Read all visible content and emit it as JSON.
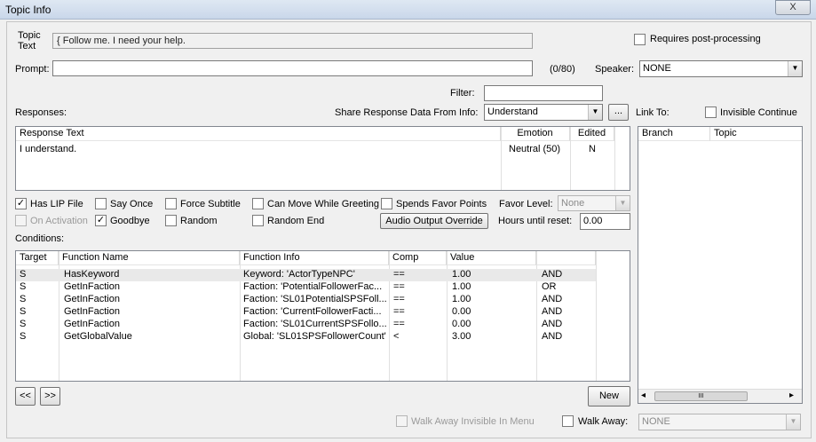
{
  "window": {
    "title": "Topic Info",
    "close_glyph": "X"
  },
  "topic": {
    "label_line1": "Topic",
    "label_line2": "Text",
    "value": "{ Follow me. I need your help.",
    "requires_post_processing_label": "Requires post-processing",
    "requires_post_processing_checked": false
  },
  "prompt": {
    "label": "Prompt:",
    "value": "",
    "counter": "(0/80)"
  },
  "speaker": {
    "label": "Speaker:",
    "value": "NONE"
  },
  "filter": {
    "label": "Filter:",
    "value": ""
  },
  "responses": {
    "label": "Responses:",
    "share_label": "Share Response Data From Info:",
    "share_value": "Understand",
    "ellipsis": "...",
    "columns": [
      "Response Text",
      "Emotion",
      "Edited"
    ],
    "rows": [
      {
        "text": "I understand.",
        "emotion": "Neutral (50)",
        "edited": "N"
      }
    ]
  },
  "link_to": {
    "label": "Link To:",
    "invisible_continue_label": "Invisible Continue",
    "invisible_continue_checked": false,
    "columns": [
      "Branch",
      "Topic"
    ],
    "scroll_left": "◂",
    "scroll_right": "▸",
    "scroll_thumb": "III"
  },
  "options": {
    "has_lip_file": {
      "label": "Has LIP File",
      "checked": true
    },
    "say_once": {
      "label": "Say Once",
      "checked": false
    },
    "force_subtitle": {
      "label": "Force Subtitle",
      "checked": false
    },
    "can_move_while_greeting": {
      "label": "Can Move While Greeting",
      "checked": false
    },
    "spends_favor_points": {
      "label": "Spends Favor Points",
      "checked": false
    },
    "favor_level_label": "Favor Level:",
    "favor_level_value": "None",
    "on_activation": {
      "label": "On Activation",
      "checked": false
    },
    "goodbye": {
      "label": "Goodbye",
      "checked": true
    },
    "random": {
      "label": "Random",
      "checked": false
    },
    "random_end": {
      "label": "Random End",
      "checked": false
    },
    "audio_output_override_label": "Audio Output Override",
    "hours_until_reset_label": "Hours until reset:",
    "hours_until_reset_value": "0.00"
  },
  "conditions": {
    "label": "Conditions:",
    "columns": [
      "Target",
      "Function Name",
      "Function Info",
      "Comp",
      "Value",
      ""
    ],
    "rows": [
      {
        "target": "S",
        "function": "HasKeyword",
        "info": "Keyword: 'ActorTypeNPC'",
        "comp": "==",
        "value": "1.00",
        "op": "AND"
      },
      {
        "target": "S",
        "function": "GetInFaction",
        "info": "Faction: 'PotentialFollowerFac...",
        "comp": "==",
        "value": "1.00",
        "op": "OR"
      },
      {
        "target": "S",
        "function": "GetInFaction",
        "info": "Faction: 'SL01PotentialSPSFoll...",
        "comp": "==",
        "value": "1.00",
        "op": "AND"
      },
      {
        "target": "S",
        "function": "GetInFaction",
        "info": "Faction: 'CurrentFollowerFacti...",
        "comp": "==",
        "value": "0.00",
        "op": "AND"
      },
      {
        "target": "S",
        "function": "GetInFaction",
        "info": "Faction: 'SL01CurrentSPSFollo...",
        "comp": "==",
        "value": "0.00",
        "op": "AND"
      },
      {
        "target": "S",
        "function": "GetGlobalValue",
        "info": "Global: 'SL01SPSFollowerCount'",
        "comp": "<",
        "value": "3.00",
        "op": "AND"
      }
    ]
  },
  "nav": {
    "prev": "<<",
    "next": ">>"
  },
  "new_button": "New",
  "walk_away_invisible": {
    "label": "Walk Away Invisible In Menu",
    "checked": false
  },
  "walk_away": {
    "label": "Walk Away:",
    "checked": false,
    "value": "NONE"
  }
}
